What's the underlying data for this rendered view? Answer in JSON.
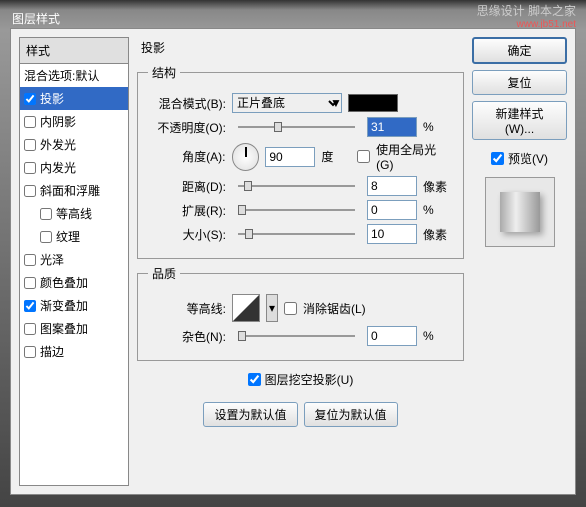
{
  "window": {
    "title": "图层样式"
  },
  "watermark": {
    "text": "思缘设计 脚本之家",
    "url": "www.jb51.net"
  },
  "sidebar": {
    "header": "样式",
    "items": [
      {
        "label": "混合选项:默认",
        "checked": null
      },
      {
        "label": "投影",
        "checked": true,
        "selected": true
      },
      {
        "label": "内阴影",
        "checked": false
      },
      {
        "label": "外发光",
        "checked": false
      },
      {
        "label": "内发光",
        "checked": false
      },
      {
        "label": "斜面和浮雕",
        "checked": false
      },
      {
        "label": "等高线",
        "checked": false,
        "indented": true
      },
      {
        "label": "纹理",
        "checked": false,
        "indented": true
      },
      {
        "label": "光泽",
        "checked": false
      },
      {
        "label": "颜色叠加",
        "checked": false
      },
      {
        "label": "渐变叠加",
        "checked": true
      },
      {
        "label": "图案叠加",
        "checked": false
      },
      {
        "label": "描边",
        "checked": false
      }
    ]
  },
  "main": {
    "title": "投影",
    "structure": {
      "legend": "结构",
      "blend_mode": {
        "label": "混合模式(B):",
        "value": "正片叠底"
      },
      "opacity": {
        "label": "不透明度(O):",
        "value": "31",
        "unit": "%"
      },
      "angle": {
        "label": "角度(A):",
        "value": "90",
        "unit": "度"
      },
      "global_light": {
        "label": "使用全局光(G)",
        "checked": false
      },
      "distance": {
        "label": "距离(D):",
        "value": "8",
        "unit": "像素"
      },
      "spread": {
        "label": "扩展(R):",
        "value": "0",
        "unit": "%"
      },
      "size": {
        "label": "大小(S):",
        "value": "10",
        "unit": "像素"
      }
    },
    "quality": {
      "legend": "品质",
      "contour": {
        "label": "等高线:"
      },
      "antialias": {
        "label": "消除锯齿(L)",
        "checked": false
      },
      "noise": {
        "label": "杂色(N):",
        "value": "0",
        "unit": "%"
      }
    },
    "knockout": {
      "label": "图层挖空投影(U)",
      "checked": true
    },
    "buttons": {
      "default": "设置为默认值",
      "reset": "复位为默认值"
    }
  },
  "right": {
    "ok": "确定",
    "reset": "复位",
    "new_style": "新建样式(W)...",
    "preview": {
      "label": "预览(V)",
      "checked": true
    }
  },
  "colors": {
    "accent": "#316ac5",
    "swatch": "#000000"
  }
}
